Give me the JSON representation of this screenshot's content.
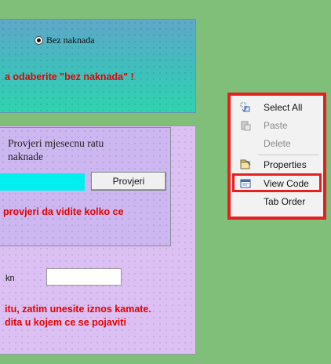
{
  "top_panel": {
    "radio_label": "Bez naknada",
    "warning": "a odaberite \"bez naknada\" !"
  },
  "check_panel": {
    "title_line1": "Provjeri mjesecnu ratu",
    "title_line2": "naknade",
    "button": "Provjeri",
    "warning": "provjeri da vidite kolko ce"
  },
  "amount": {
    "label": "kn",
    "warning_line1": "itu, zatim unesite iznos kamate.",
    "warning_line2": "dita u kojem ce se pojaviti"
  },
  "context_menu": {
    "items": [
      {
        "label": "Select All",
        "icon": "select-all-icon",
        "enabled": true
      },
      {
        "label": "Paste",
        "icon": "paste-icon",
        "enabled": false
      },
      {
        "label": "Delete",
        "icon": "none",
        "enabled": false
      },
      {
        "label": "Properties",
        "icon": "properties-icon",
        "enabled": true
      },
      {
        "label": "View Code",
        "icon": "view-code-icon",
        "enabled": true
      },
      {
        "label": "Tab Order",
        "icon": "none",
        "enabled": true
      }
    ]
  },
  "colors": {
    "highlight_red": "#e52020",
    "warning_red": "#e60000",
    "desktop_green": "#7fbf7a"
  }
}
